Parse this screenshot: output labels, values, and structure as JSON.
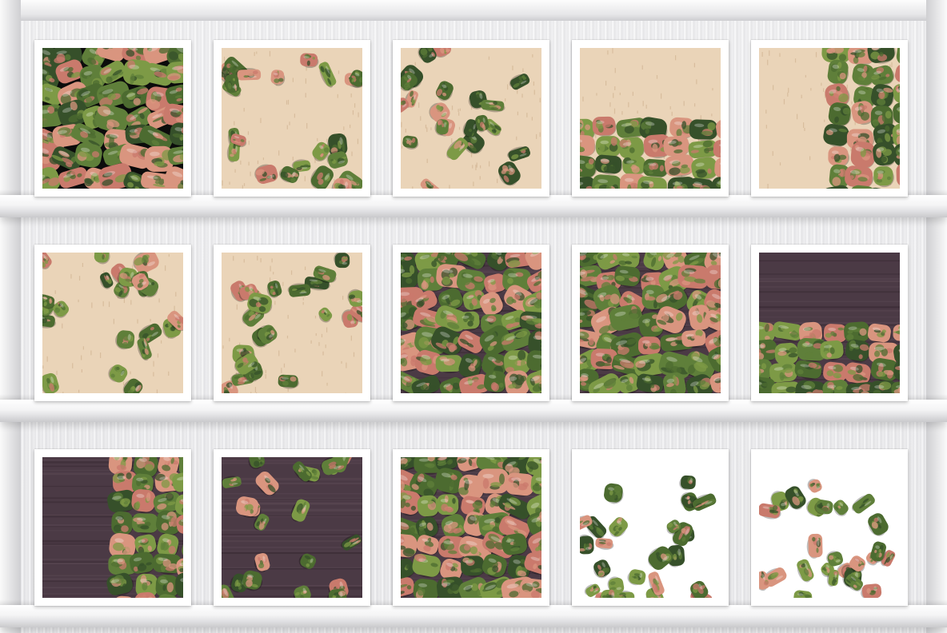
{
  "gallery": {
    "rows": 3,
    "columns": 5,
    "photos": [
      {
        "background": "black",
        "scene": "full"
      },
      {
        "background": "light-wood",
        "scene": "scattered"
      },
      {
        "background": "light-wood",
        "scene": "scattered"
      },
      {
        "background": "light-wood",
        "scene": "row-bottom"
      },
      {
        "background": "light-wood",
        "scene": "column-right"
      },
      {
        "background": "light-wood",
        "scene": "scattered"
      },
      {
        "background": "light-wood",
        "scene": "scattered"
      },
      {
        "background": "dark-wood",
        "scene": "full"
      },
      {
        "background": "dark-wood",
        "scene": "full"
      },
      {
        "background": "dark-wood",
        "scene": "row-bottom"
      },
      {
        "background": "dark-wood",
        "scene": "column-right"
      },
      {
        "background": "dark-wood",
        "scene": "scattered"
      },
      {
        "background": "dark-wood",
        "scene": "full"
      },
      {
        "background": "white",
        "scene": "falling"
      },
      {
        "background": "white",
        "scene": "falling"
      }
    ]
  },
  "colors": {
    "shelf": "#f4f4f5",
    "light_wood": "#ead4b8",
    "dark_wood": "#4b3a45",
    "black": "#0c0c0c",
    "stone_green": "#5f7f3a",
    "stone_dark_green": "#36502a",
    "stone_pink": "#c97a6c",
    "stone_salmon": "#d9957f"
  }
}
